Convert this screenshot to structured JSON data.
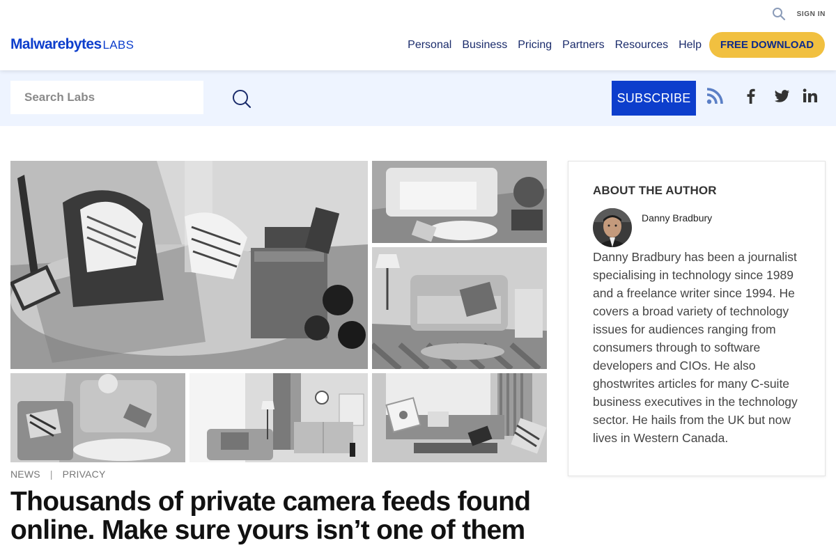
{
  "header": {
    "logo_main": "Malwarebytes",
    "logo_sub": "LABS",
    "sign_in": "SIGN IN",
    "nav": [
      "Personal",
      "Business",
      "Pricing",
      "Partners",
      "Resources",
      "Help"
    ],
    "cta": "FREE DOWNLOAD",
    "brand_color": "#0d3ecc",
    "cta_color": "#f1c040"
  },
  "subbar": {
    "search_placeholder": "Search Labs",
    "subscribe": "SUBSCRIBE",
    "social_icons": [
      "rss-icon",
      "facebook-icon",
      "twitter-icon",
      "linkedin-icon"
    ],
    "background": "#eef4ff"
  },
  "article": {
    "categories": [
      "NEWS",
      "PRIVACY"
    ],
    "separator": "|",
    "title": "Thousands of private camera feeds found online. Make sure yours isn’t one of them",
    "hero_image": "grayscale collage of living room camera feeds"
  },
  "author": {
    "heading": "ABOUT THE AUTHOR",
    "name": "Danny Bradbury",
    "bio": "Danny Bradbury has been a journalist specialising in technology since 1989 and a freelance writer since 1994. He covers a broad variety of technology issues for audiences ranging from consumers through to software developers and CIOs. He also ghostwrites articles for many C-suite business executives in the technology sector. He hails from the UK but now lives in Western Canada."
  }
}
